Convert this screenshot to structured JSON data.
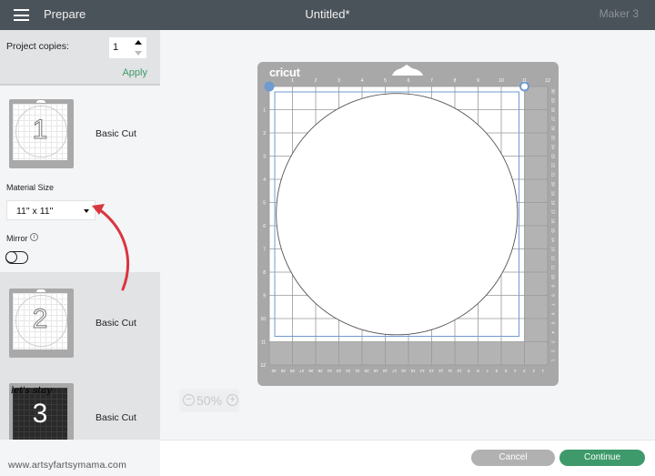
{
  "header": {
    "menu_icon": "hamburger-menu-icon",
    "section": "Prepare",
    "title": "Untitled*",
    "machine": "Maker 3"
  },
  "sidebar": {
    "copies_label": "Project copies:",
    "copies_value": "1",
    "apply_label": "Apply",
    "mats": [
      {
        "number": "1",
        "label": "Basic Cut",
        "style": "light",
        "selected": true
      },
      {
        "number": "2",
        "label": "Basic Cut",
        "style": "light",
        "selected": false
      },
      {
        "number": "3",
        "label": "Basic Cut",
        "style": "dark",
        "script_text": "let's stay",
        "selected": false
      }
    ],
    "material_size_label": "Material Size",
    "material_size_value": "11\" x 11\"",
    "mirror_label": "Mirror",
    "mirror_on": false,
    "info_icon": "i"
  },
  "canvas": {
    "mat_brand": "cricut",
    "top_ruler": [
      "1",
      "2",
      "3",
      "4",
      "5",
      "6",
      "7",
      "8",
      "9",
      "10",
      "11",
      "12"
    ],
    "left_ruler": [
      "1",
      "2",
      "3",
      "4",
      "5",
      "6",
      "7",
      "8",
      "9",
      "10",
      "11",
      "12"
    ],
    "bottom_ruler": [
      "30",
      "29",
      "28",
      "27",
      "26",
      "25",
      "24",
      "23",
      "22",
      "21",
      "20",
      "19",
      "18",
      "17",
      "16",
      "15",
      "14",
      "13",
      "12",
      "11",
      "10",
      "9",
      "8",
      "7",
      "6",
      "5",
      "4",
      "3",
      "2",
      "1"
    ],
    "right_ruler": [
      "30",
      "29",
      "28",
      "27",
      "26",
      "25",
      "24",
      "23",
      "22",
      "21",
      "20",
      "19",
      "18",
      "17",
      "16",
      "15",
      "14",
      "13",
      "12",
      "11",
      "10",
      "9",
      "8",
      "7",
      "6",
      "5",
      "4",
      "3",
      "2",
      "1"
    ],
    "shape": "circle",
    "zoom_level": "50%",
    "annotation_color": "#d9363e"
  },
  "footer": {
    "watermark": "www.artsyfartsymama.com",
    "cancel_label": "Cancel",
    "continue_label": "Continue"
  },
  "colors": {
    "header_bg": "#4b535a",
    "accent_green": "#3e9a6a",
    "mat_gray": "#a8a8a8",
    "selection_blue": "#6f9bd1"
  }
}
